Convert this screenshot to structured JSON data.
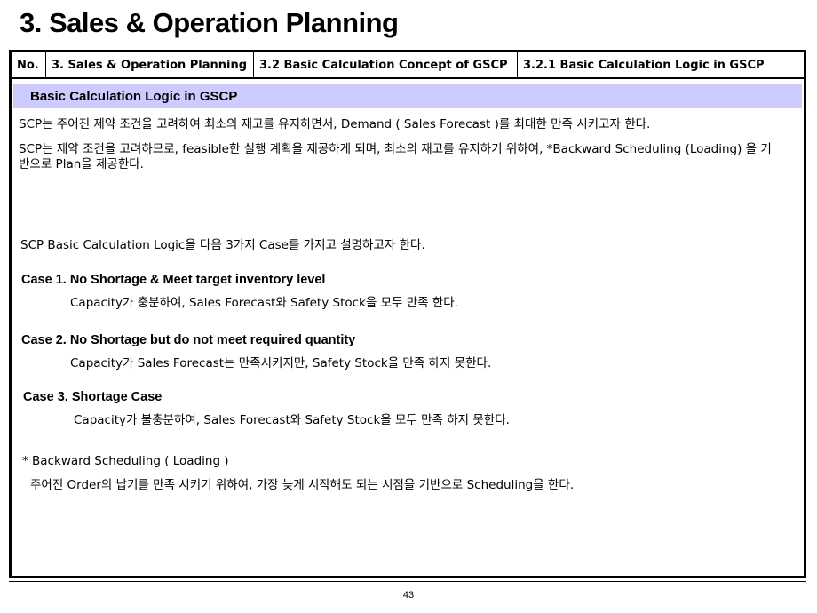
{
  "page_title": "3. Sales & Operation Planning",
  "header": {
    "no": "No.",
    "chapter": "3. Sales & Operation Planning",
    "section": "3.2 Basic Calculation Concept of GSCP",
    "subsection": "3.2.1 Basic Calculation Logic in GSCP"
  },
  "section_title": "Basic Calculation  Logic in GSCP",
  "intro": [
    "SCP는 주어진 제약 조건을 고려하여 최소의 재고를 유지하면서, Demand ( Sales Forecast )를 최대한 만족 시키고자 한다.",
    "SCP는 제약 조건을 고려하므로, feasible한 실행 계획을 제공하게 되며, 최소의 재고를 유지하기 위하여, *Backward Scheduling (Loading) 을 기반으로 Plan을 제공한다."
  ],
  "cases_intro": "SCP Basic Calculation Logic을 다음 3가지 Case를 가지고 설명하고자 한다.",
  "cases": [
    {
      "title": "Case 1. No Shortage & Meet target inventory level",
      "desc": "Capacity가 충분하여, Sales Forecast와 Safety Stock을 모두 만족 한다."
    },
    {
      "title": "Case 2. No Shortage but do not meet required quantity",
      "desc": "Capacity가 Sales Forecast는 만족시키지만,  Safety Stock을 만족 하지 못한다."
    },
    {
      "title": "Case 3. Shortage Case",
      "desc": "Capacity가 불충분하여, Sales Forecast와 Safety Stock을 모두 만족 하지 못한다."
    }
  ],
  "footnote": {
    "title": "* Backward Scheduling ( Loading )",
    "desc": "주어진 Order의 납기를 만족 시키기 위하여, 가장 늦게 시작해도 되는 시점을 기반으로 Scheduling을 한다."
  },
  "page_number": "43",
  "colors": {
    "section_band": "#ccccff",
    "border": "#000000"
  }
}
